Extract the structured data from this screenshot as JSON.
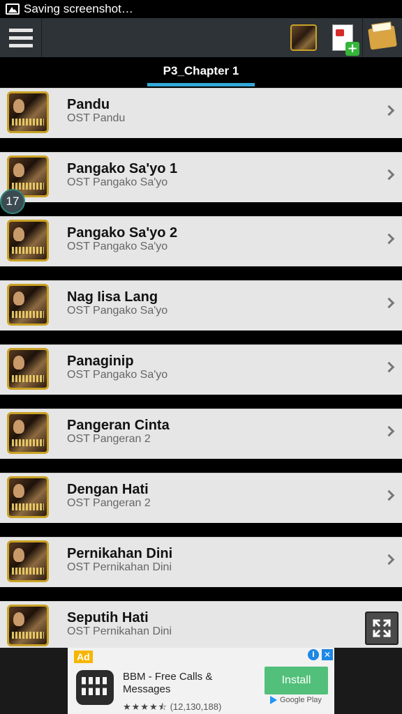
{
  "status_bar": {
    "text": "Saving screenshot…",
    "icon": "image-icon"
  },
  "action_bar": {
    "menu_icon": "hamburger-menu-icon",
    "actions": [
      "album-thumbnail-icon",
      "add-pdf-icon",
      "folder-icon"
    ]
  },
  "tab": {
    "label": "P3_Chapter 1",
    "accent": "#33a8d9"
  },
  "badge": "17",
  "songs": [
    {
      "title": "Pandu",
      "subtitle": "OST Pandu"
    },
    {
      "title": "Pangako Sa'yo 1",
      "subtitle": "OST Pangako Sa'yo"
    },
    {
      "title": "Pangako Sa'yo 2",
      "subtitle": "OST Pangako Sa'yo"
    },
    {
      "title": "Nag Iisa Lang",
      "subtitle": "OST Pangako Sa'yo"
    },
    {
      "title": "Panaginip",
      "subtitle": "OST Pangako Sa'yo"
    },
    {
      "title": "Pangeran Cinta",
      "subtitle": "OST Pangeran 2"
    },
    {
      "title": "Dengan Hati",
      "subtitle": "OST Pangeran 2"
    },
    {
      "title": "Pernikahan Dini",
      "subtitle": "OST Pernikahan Dini"
    },
    {
      "title": "Seputih Hati",
      "subtitle": "OST Pernikahan Dini"
    }
  ],
  "ad": {
    "tag": "Ad",
    "title": "BBM - Free Calls & Messages",
    "stars": "★★★★⯪",
    "rating_count": "(12,130,188)",
    "install_label": "Install",
    "store_label": "Google Play",
    "install_color": "#52c07a"
  }
}
